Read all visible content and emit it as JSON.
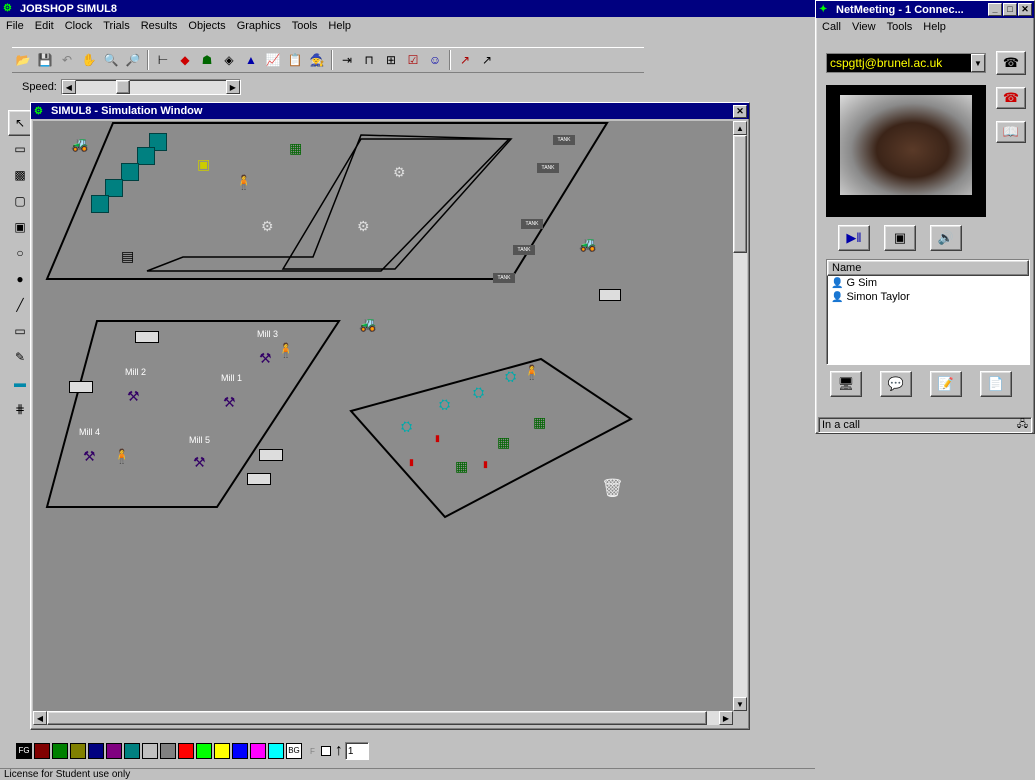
{
  "simul8": {
    "title": "JOBSHOP  SIMUL8",
    "menu": [
      "File",
      "Edit",
      "Clock",
      "Trials",
      "Results",
      "Objects",
      "Graphics",
      "Tools",
      "Help"
    ],
    "speed_label": "Speed:",
    "sim_window_title": "SIMUL8 - Simulation Window",
    "status_text": "License for Student use only",
    "fg_label": "FG",
    "bg_label": "BG",
    "f_label": "F",
    "line_width_value": "1",
    "palette": [
      "#800000",
      "#008000",
      "#808000",
      "#000080",
      "#800080",
      "#008080",
      "#c0c0c0",
      "#808080",
      "#ff0000",
      "#00ff00",
      "#ffff00",
      "#0000ff",
      "#ff00ff",
      "#00ffff"
    ],
    "mills": [
      {
        "label": "Mill 3"
      },
      {
        "label": "Mill 2"
      },
      {
        "label": "Mill 1"
      },
      {
        "label": "Mill 4"
      },
      {
        "label": "Mill 5"
      }
    ],
    "tank_label": "TANK"
  },
  "netmeeting": {
    "title": "NetMeeting - 1 Connec...",
    "menu": [
      "Call",
      "View",
      "Tools",
      "Help"
    ],
    "address": "cspgttj@brunel.ac.uk",
    "list_header": "Name",
    "participants": [
      "G Sim",
      "Simon Taylor"
    ],
    "status": "In a call"
  }
}
